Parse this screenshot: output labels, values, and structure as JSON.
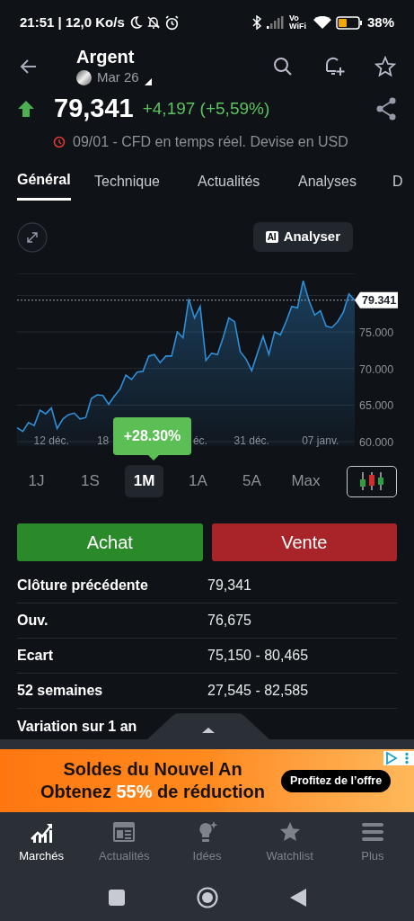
{
  "status_bar": {
    "time": "21:51 | 12,0 Ko/s",
    "network_label": "Vo WiFi",
    "battery": "38%"
  },
  "header": {
    "title": "Argent",
    "contract": "Mar 26"
  },
  "quote": {
    "price": "79,341",
    "change": "+4,197 (+5,59%)",
    "rising": true,
    "note": "09/01 - CFD en temps réel. Devise en USD"
  },
  "tabs": [
    {
      "label": "Général",
      "selected": true
    },
    {
      "label": "Technique",
      "selected": false
    },
    {
      "label": "Actualités",
      "selected": false
    },
    {
      "label": "Analyses",
      "selected": false
    },
    {
      "label": "D",
      "selected": false
    }
  ],
  "analyze_button": {
    "badge": "AI",
    "label": "Analyser"
  },
  "chart": {
    "chart_data": {
      "type": "area",
      "grid": true,
      "ylim": [
        60,
        83
      ],
      "ref_lines": [
        {
          "axis": "y",
          "value": 79.341,
          "label": "79.341"
        }
      ],
      "categories": [
        null,
        null,
        null,
        null,
        null,
        null,
        "12 déc.",
        null,
        null,
        null,
        null,
        null,
        null,
        null,
        null,
        "18",
        null,
        null,
        null,
        null,
        null,
        null,
        null,
        null,
        null,
        null,
        null,
        null,
        null,
        null,
        null,
        null,
        "éc.",
        null,
        null,
        null,
        null,
        null,
        null,
        null,
        null,
        "31 déc.",
        null,
        null,
        null,
        null,
        null,
        null,
        null,
        null,
        null,
        null,
        null,
        "07 janv.",
        null,
        null,
        null,
        null,
        null,
        null
      ],
      "series": [
        {
          "color": "#2f8fd8",
          "values": [
            61.9,
            61.4,
            62.6,
            62.2,
            64.3,
            63.8,
            64.6,
            61.8,
            63.1,
            63.7,
            63.9,
            63.1,
            63.3,
            65.9,
            66.4,
            66.3,
            65.1,
            66.2,
            67.2,
            69.1,
            68.5,
            69.5,
            69.6,
            71.7,
            71.9,
            70.8,
            71.7,
            71.7,
            75.0,
            74.2,
            79.5,
            76.9,
            78.5,
            71.1,
            72.1,
            71.9,
            74.2,
            76.9,
            76.4,
            72.3,
            71.3,
            69.7,
            72.1,
            74.4,
            71.9,
            75.0,
            74.6,
            76.4,
            78.5,
            78.3,
            82.0,
            79.3,
            77.3,
            77.9,
            75.8,
            75.6,
            76.4,
            77.7,
            80.2,
            79.3
          ]
        }
      ],
      "yticks": [
        {
          "value": 60,
          "label": "60.000"
        },
        {
          "value": 65,
          "label": "65.000"
        },
        {
          "value": 70,
          "label": "70.000"
        },
        {
          "value": 75,
          "label": "75.000"
        }
      ]
    }
  },
  "period_change": "+28.30%",
  "ranges": [
    {
      "label": "1J",
      "selected": false
    },
    {
      "label": "1S",
      "selected": false
    },
    {
      "label": "1M",
      "selected": true
    },
    {
      "label": "1A",
      "selected": false
    },
    {
      "label": "5A",
      "selected": false
    },
    {
      "label": "Max",
      "selected": false
    }
  ],
  "candlestick_toggle": {
    "selected": false
  },
  "actions": [
    {
      "label": "Achat",
      "kind": "buy"
    },
    {
      "label": "Vente",
      "kind": "sell"
    }
  ],
  "stats": [
    {
      "label": "Clôture précédente",
      "value": "79,341"
    },
    {
      "label": "Ouv.",
      "value": "76,675"
    },
    {
      "label": "Ecart",
      "value": "75,150 - 80,465"
    },
    {
      "label": "52 semaines",
      "value": "27,545 - 82,585"
    },
    {
      "label": "Variation sur 1 an"
    }
  ],
  "ad": {
    "title": "Soldes du Nouvel An",
    "line2": [
      {
        "text": "Obtenez ",
        "highlight": false
      },
      {
        "text": "55%",
        "highlight": true
      },
      {
        "text": " de réduction",
        "highlight": false
      }
    ],
    "cta": "Profitez de l’offre"
  },
  "bottom_nav": [
    {
      "label": "Marchés",
      "selected": true
    },
    {
      "label": "Actualités",
      "selected": false
    },
    {
      "label": "Idées",
      "selected": false
    },
    {
      "label": "Watchlist",
      "selected": false
    },
    {
      "label": "Plus",
      "selected": false
    }
  ]
}
